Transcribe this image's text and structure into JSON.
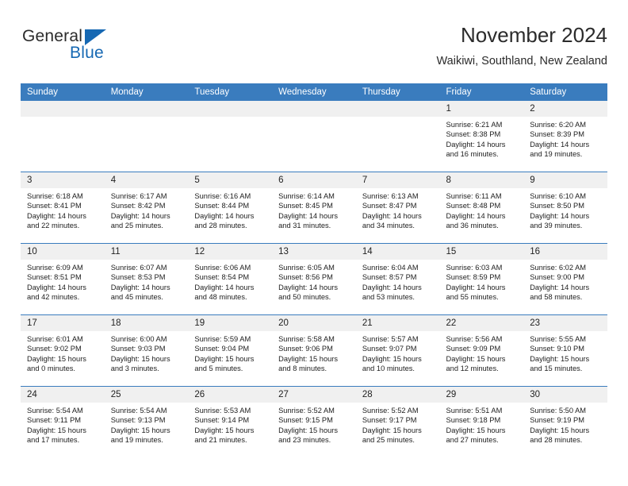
{
  "brand": {
    "general": "General",
    "blue": "Blue",
    "triangle_color": "#1668b3"
  },
  "header": {
    "title": "November 2024",
    "subtitle": "Waikiwi, Southland, New Zealand"
  },
  "theme": {
    "header_blue": "#3a7cbe",
    "daynum_bg": "#f0f0f0",
    "text": "#1d1d1d"
  },
  "labels": {
    "sunrise_prefix": "Sunrise:",
    "sunset_prefix": "Sunset:",
    "daylight_prefix": "Daylight:"
  },
  "weekdays": [
    "Sunday",
    "Monday",
    "Tuesday",
    "Wednesday",
    "Thursday",
    "Friday",
    "Saturday"
  ],
  "weeks": [
    [
      {
        "day": "",
        "empty": true,
        "sunrise": "",
        "sunset": "",
        "daylight1": "",
        "daylight2": ""
      },
      {
        "day": "",
        "empty": true,
        "sunrise": "",
        "sunset": "",
        "daylight1": "",
        "daylight2": ""
      },
      {
        "day": "",
        "empty": true,
        "sunrise": "",
        "sunset": "",
        "daylight1": "",
        "daylight2": ""
      },
      {
        "day": "",
        "empty": true,
        "sunrise": "",
        "sunset": "",
        "daylight1": "",
        "daylight2": ""
      },
      {
        "day": "",
        "empty": true,
        "sunrise": "",
        "sunset": "",
        "daylight1": "",
        "daylight2": ""
      },
      {
        "day": "1",
        "sunrise": "Sunrise: 6:21 AM",
        "sunset": "Sunset: 8:38 PM",
        "daylight1": "Daylight: 14 hours",
        "daylight2": "and 16 minutes."
      },
      {
        "day": "2",
        "sunrise": "Sunrise: 6:20 AM",
        "sunset": "Sunset: 8:39 PM",
        "daylight1": "Daylight: 14 hours",
        "daylight2": "and 19 minutes."
      }
    ],
    [
      {
        "day": "3",
        "sunrise": "Sunrise: 6:18 AM",
        "sunset": "Sunset: 8:41 PM",
        "daylight1": "Daylight: 14 hours",
        "daylight2": "and 22 minutes."
      },
      {
        "day": "4",
        "sunrise": "Sunrise: 6:17 AM",
        "sunset": "Sunset: 8:42 PM",
        "daylight1": "Daylight: 14 hours",
        "daylight2": "and 25 minutes."
      },
      {
        "day": "5",
        "sunrise": "Sunrise: 6:16 AM",
        "sunset": "Sunset: 8:44 PM",
        "daylight1": "Daylight: 14 hours",
        "daylight2": "and 28 minutes."
      },
      {
        "day": "6",
        "sunrise": "Sunrise: 6:14 AM",
        "sunset": "Sunset: 8:45 PM",
        "daylight1": "Daylight: 14 hours",
        "daylight2": "and 31 minutes."
      },
      {
        "day": "7",
        "sunrise": "Sunrise: 6:13 AM",
        "sunset": "Sunset: 8:47 PM",
        "daylight1": "Daylight: 14 hours",
        "daylight2": "and 34 minutes."
      },
      {
        "day": "8",
        "sunrise": "Sunrise: 6:11 AM",
        "sunset": "Sunset: 8:48 PM",
        "daylight1": "Daylight: 14 hours",
        "daylight2": "and 36 minutes."
      },
      {
        "day": "9",
        "sunrise": "Sunrise: 6:10 AM",
        "sunset": "Sunset: 8:50 PM",
        "daylight1": "Daylight: 14 hours",
        "daylight2": "and 39 minutes."
      }
    ],
    [
      {
        "day": "10",
        "sunrise": "Sunrise: 6:09 AM",
        "sunset": "Sunset: 8:51 PM",
        "daylight1": "Daylight: 14 hours",
        "daylight2": "and 42 minutes."
      },
      {
        "day": "11",
        "sunrise": "Sunrise: 6:07 AM",
        "sunset": "Sunset: 8:53 PM",
        "daylight1": "Daylight: 14 hours",
        "daylight2": "and 45 minutes."
      },
      {
        "day": "12",
        "sunrise": "Sunrise: 6:06 AM",
        "sunset": "Sunset: 8:54 PM",
        "daylight1": "Daylight: 14 hours",
        "daylight2": "and 48 minutes."
      },
      {
        "day": "13",
        "sunrise": "Sunrise: 6:05 AM",
        "sunset": "Sunset: 8:56 PM",
        "daylight1": "Daylight: 14 hours",
        "daylight2": "and 50 minutes."
      },
      {
        "day": "14",
        "sunrise": "Sunrise: 6:04 AM",
        "sunset": "Sunset: 8:57 PM",
        "daylight1": "Daylight: 14 hours",
        "daylight2": "and 53 minutes."
      },
      {
        "day": "15",
        "sunrise": "Sunrise: 6:03 AM",
        "sunset": "Sunset: 8:59 PM",
        "daylight1": "Daylight: 14 hours",
        "daylight2": "and 55 minutes."
      },
      {
        "day": "16",
        "sunrise": "Sunrise: 6:02 AM",
        "sunset": "Sunset: 9:00 PM",
        "daylight1": "Daylight: 14 hours",
        "daylight2": "and 58 minutes."
      }
    ],
    [
      {
        "day": "17",
        "sunrise": "Sunrise: 6:01 AM",
        "sunset": "Sunset: 9:02 PM",
        "daylight1": "Daylight: 15 hours",
        "daylight2": "and 0 minutes."
      },
      {
        "day": "18",
        "sunrise": "Sunrise: 6:00 AM",
        "sunset": "Sunset: 9:03 PM",
        "daylight1": "Daylight: 15 hours",
        "daylight2": "and 3 minutes."
      },
      {
        "day": "19",
        "sunrise": "Sunrise: 5:59 AM",
        "sunset": "Sunset: 9:04 PM",
        "daylight1": "Daylight: 15 hours",
        "daylight2": "and 5 minutes."
      },
      {
        "day": "20",
        "sunrise": "Sunrise: 5:58 AM",
        "sunset": "Sunset: 9:06 PM",
        "daylight1": "Daylight: 15 hours",
        "daylight2": "and 8 minutes."
      },
      {
        "day": "21",
        "sunrise": "Sunrise: 5:57 AM",
        "sunset": "Sunset: 9:07 PM",
        "daylight1": "Daylight: 15 hours",
        "daylight2": "and 10 minutes."
      },
      {
        "day": "22",
        "sunrise": "Sunrise: 5:56 AM",
        "sunset": "Sunset: 9:09 PM",
        "daylight1": "Daylight: 15 hours",
        "daylight2": "and 12 minutes."
      },
      {
        "day": "23",
        "sunrise": "Sunrise: 5:55 AM",
        "sunset": "Sunset: 9:10 PM",
        "daylight1": "Daylight: 15 hours",
        "daylight2": "and 15 minutes."
      }
    ],
    [
      {
        "day": "24",
        "sunrise": "Sunrise: 5:54 AM",
        "sunset": "Sunset: 9:11 PM",
        "daylight1": "Daylight: 15 hours",
        "daylight2": "and 17 minutes."
      },
      {
        "day": "25",
        "sunrise": "Sunrise: 5:54 AM",
        "sunset": "Sunset: 9:13 PM",
        "daylight1": "Daylight: 15 hours",
        "daylight2": "and 19 minutes."
      },
      {
        "day": "26",
        "sunrise": "Sunrise: 5:53 AM",
        "sunset": "Sunset: 9:14 PM",
        "daylight1": "Daylight: 15 hours",
        "daylight2": "and 21 minutes."
      },
      {
        "day": "27",
        "sunrise": "Sunrise: 5:52 AM",
        "sunset": "Sunset: 9:15 PM",
        "daylight1": "Daylight: 15 hours",
        "daylight2": "and 23 minutes."
      },
      {
        "day": "28",
        "sunrise": "Sunrise: 5:52 AM",
        "sunset": "Sunset: 9:17 PM",
        "daylight1": "Daylight: 15 hours",
        "daylight2": "and 25 minutes."
      },
      {
        "day": "29",
        "sunrise": "Sunrise: 5:51 AM",
        "sunset": "Sunset: 9:18 PM",
        "daylight1": "Daylight: 15 hours",
        "daylight2": "and 27 minutes."
      },
      {
        "day": "30",
        "sunrise": "Sunrise: 5:50 AM",
        "sunset": "Sunset: 9:19 PM",
        "daylight1": "Daylight: 15 hours",
        "daylight2": "and 28 minutes."
      }
    ]
  ]
}
